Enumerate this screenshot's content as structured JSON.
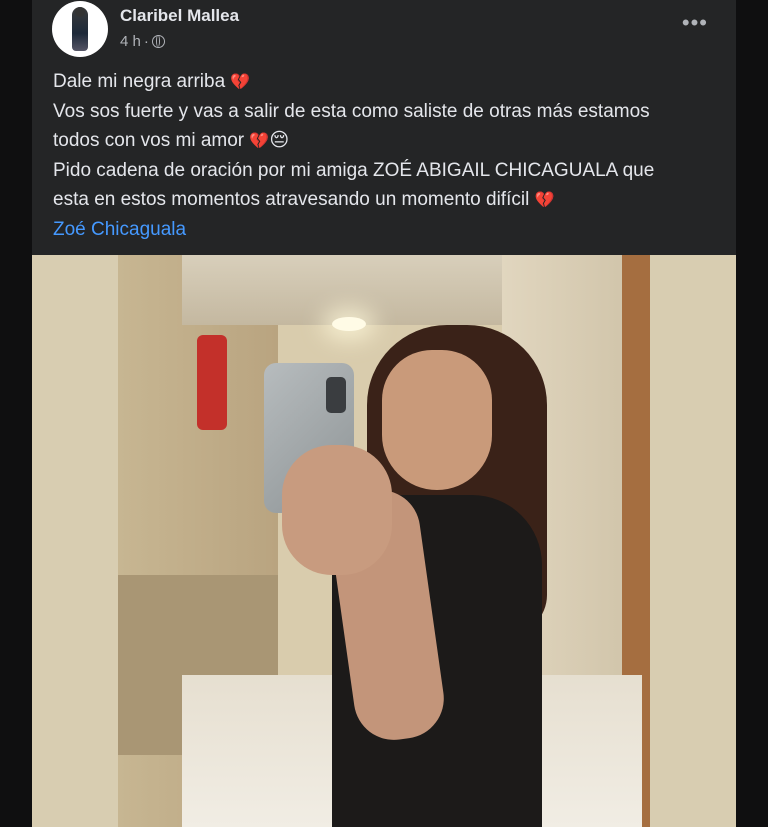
{
  "post": {
    "author": "Claribel Mallea",
    "time": "4 h",
    "separator": "·",
    "more_label": "•••",
    "text_lines": [
      "Dale mi negra arriba",
      "Vos sos fuerte y vas a salir de esta como saliste de otras más estamos",
      "todos con vos mi amor",
      "Pido cadena de oración por mi amiga ZOÉ ABIGAIL CHICAGUALA  que",
      "esta en estos momentos atravesando un momento difícil"
    ],
    "emoji": {
      "broken_heart": "💔",
      "sad_face": "😔"
    },
    "tag": "Zoé Chicaguala"
  },
  "colors": {
    "background": "#242526",
    "text": "#e4e6eb",
    "secondary": "#b0b3b8",
    "link": "#4599ff"
  },
  "icons": {
    "privacy": "globe-icon",
    "more": "more-options-icon"
  }
}
